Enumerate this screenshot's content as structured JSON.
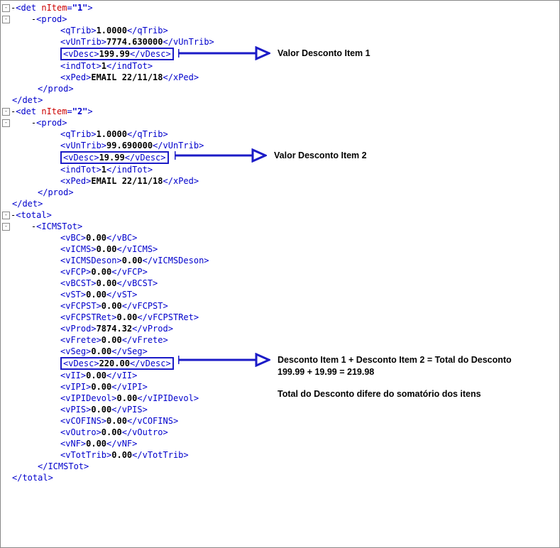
{
  "det1": {
    "nItemAttr": "nItem",
    "nItemVal": "\"1\"",
    "prod": {
      "qTrib": "1.0000",
      "vUnTrib": "7774.630000",
      "vDesc": "199.99",
      "indTot": "1",
      "xPed": "EMAIL 22/11/18"
    }
  },
  "det2": {
    "nItemAttr": "nItem",
    "nItemVal": "\"2\"",
    "prod": {
      "qTrib": "1.0000",
      "vUnTrib": "99.690000",
      "vDesc": "19.99",
      "indTot": "1",
      "xPed": "EMAIL 22/11/18"
    }
  },
  "total": {
    "vBC": "0.00",
    "vICMS": "0.00",
    "vICMSDeson": "0.00",
    "vFCP": "0.00",
    "vBCST": "0.00",
    "vST": "0.00",
    "vFCPST": "0.00",
    "vFCPSTRet": "0.00",
    "vProd": "7874.32",
    "vFrete": "0.00",
    "vSeg": "0.00",
    "vDesc": "220.00",
    "vII": "0.00",
    "vIPI": "0.00",
    "vIPIDevol": "0.00",
    "vPIS": "0.00",
    "vCOFINS": "0.00",
    "vOutro": "0.00",
    "vNF": "0.00",
    "vTotTrib": "0.00"
  },
  "annot": {
    "a1": "Valor Desconto Item 1",
    "a2": "Valor Desconto Item 2",
    "a3l1": "Desconto Item 1 + Desconto Item 2 = Total do Desconto",
    "a3l2": "199.99 + 19.99 = 219.98",
    "a3l3": "Total do Desconto difere do somatório dos itens"
  }
}
